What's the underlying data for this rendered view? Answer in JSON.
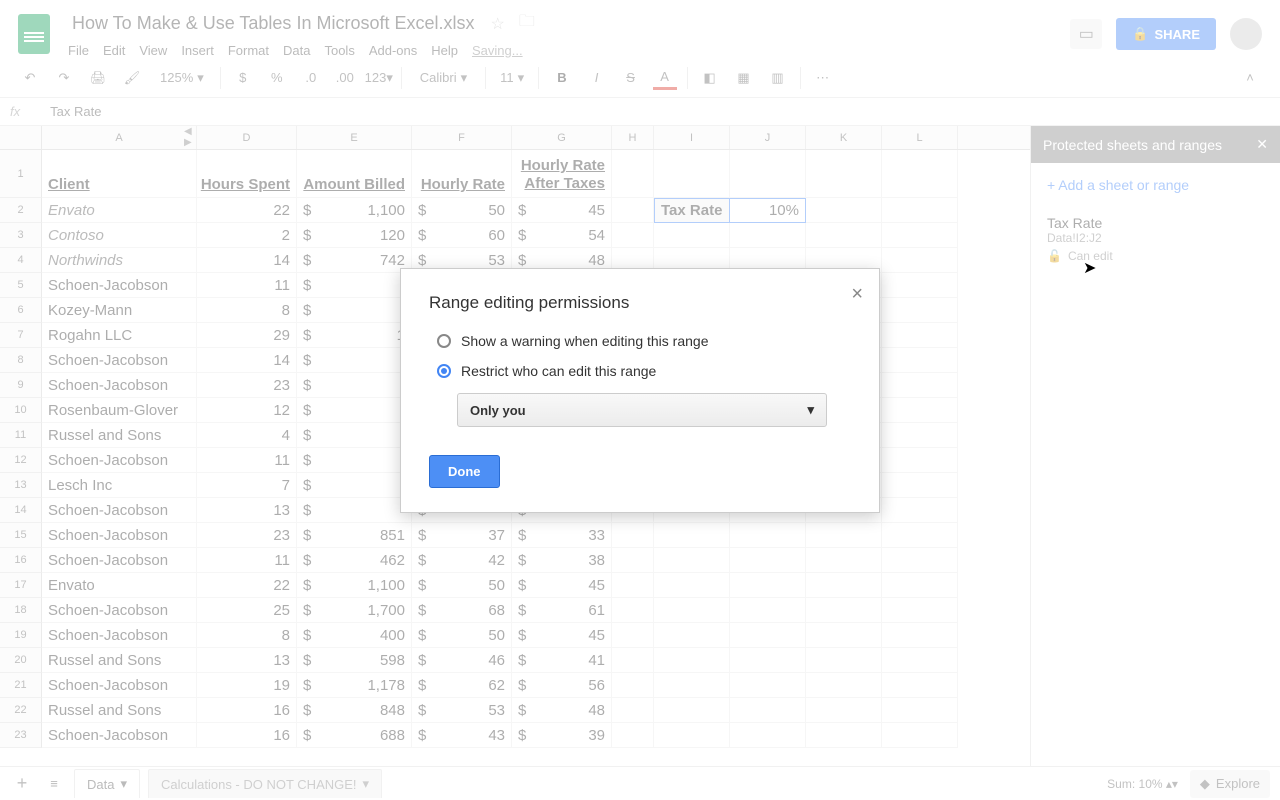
{
  "header": {
    "doc_title": "How To Make & Use Tables In Microsoft Excel.xlsx",
    "menu": {
      "file": "File",
      "edit": "Edit",
      "view": "View",
      "insert": "Insert",
      "format": "Format",
      "data": "Data",
      "tools": "Tools",
      "addons": "Add-ons",
      "help": "Help",
      "saving": "Saving..."
    },
    "share": "SHARE"
  },
  "toolbar": {
    "zoom": "125%",
    "currency": "$",
    "percent": "%",
    "dec1": ".0",
    "dec2": ".00",
    "num": "123",
    "font": "Calibri",
    "font_size": "11"
  },
  "formula": {
    "value": "Tax Rate"
  },
  "columns": [
    "A",
    "D",
    "E",
    "F",
    "G",
    "H",
    "I",
    "J",
    "K",
    "L"
  ],
  "sheet": {
    "headers": {
      "client": "Client",
      "hours": "Hours Spent",
      "amount": "Amount Billed",
      "rate": "Hourly Rate",
      "after": "Hourly Rate After Taxes"
    },
    "taxrate_label": "Tax Rate",
    "taxrate_value": "10%",
    "rows": [
      {
        "n": 2,
        "client": "Envato",
        "hours": "22",
        "amt": "1,100",
        "rate": "50",
        "after": "45"
      },
      {
        "n": 3,
        "client": "Contoso",
        "hours": "2",
        "amt": "120",
        "rate": "60",
        "after": "54"
      },
      {
        "n": 4,
        "client": "Northwinds",
        "hours": "14",
        "amt": "742",
        "rate": "53",
        "after": "48"
      },
      {
        "n": 5,
        "client": "Schoen-Jacobson",
        "hours": "11",
        "amt": "",
        "rate": "",
        "after": ""
      },
      {
        "n": 6,
        "client": "Kozey-Mann",
        "hours": "8",
        "amt": "",
        "rate": "",
        "after": ""
      },
      {
        "n": 7,
        "client": "Rogahn LLC",
        "hours": "29",
        "amt": "1",
        "rate": "",
        "after": ""
      },
      {
        "n": 8,
        "client": "Schoen-Jacobson",
        "hours": "14",
        "amt": "",
        "rate": "",
        "after": ""
      },
      {
        "n": 9,
        "client": "Schoen-Jacobson",
        "hours": "23",
        "amt": "",
        "rate": "",
        "after": ""
      },
      {
        "n": 10,
        "client": "Rosenbaum-Glover",
        "hours": "12",
        "amt": "",
        "rate": "",
        "after": ""
      },
      {
        "n": 11,
        "client": "Russel and Sons",
        "hours": "4",
        "amt": "",
        "rate": "",
        "after": ""
      },
      {
        "n": 12,
        "client": "Schoen-Jacobson",
        "hours": "11",
        "amt": "",
        "rate": "",
        "after": ""
      },
      {
        "n": 13,
        "client": "Lesch Inc",
        "hours": "7",
        "amt": "",
        "rate": "",
        "after": ""
      },
      {
        "n": 14,
        "client": "Schoen-Jacobson",
        "hours": "13",
        "amt": "",
        "rate": "",
        "after": ""
      },
      {
        "n": 15,
        "client": "Schoen-Jacobson",
        "hours": "23",
        "amt": "851",
        "rate": "37",
        "after": "33"
      },
      {
        "n": 16,
        "client": "Schoen-Jacobson",
        "hours": "11",
        "amt": "462",
        "rate": "42",
        "after": "38"
      },
      {
        "n": 17,
        "client": "Envato",
        "hours": "22",
        "amt": "1,100",
        "rate": "50",
        "after": "45"
      },
      {
        "n": 18,
        "client": "Schoen-Jacobson",
        "hours": "25",
        "amt": "1,700",
        "rate": "68",
        "after": "61"
      },
      {
        "n": 19,
        "client": "Schoen-Jacobson",
        "hours": "8",
        "amt": "400",
        "rate": "50",
        "after": "45"
      },
      {
        "n": 20,
        "client": "Russel and Sons",
        "hours": "13",
        "amt": "598",
        "rate": "46",
        "after": "41"
      },
      {
        "n": 21,
        "client": "Schoen-Jacobson",
        "hours": "19",
        "amt": "1,178",
        "rate": "62",
        "after": "56"
      },
      {
        "n": 22,
        "client": "Russel and Sons",
        "hours": "16",
        "amt": "848",
        "rate": "53",
        "after": "48"
      },
      {
        "n": 23,
        "client": "Schoen-Jacobson",
        "hours": "16",
        "amt": "688",
        "rate": "43",
        "after": "39"
      }
    ]
  },
  "panel": {
    "title": "Protected sheets and ranges",
    "add": "+ Add a sheet or range",
    "item_title": "Tax Rate",
    "item_sub": "Data!I2:J2",
    "can_edit": "Can edit"
  },
  "modal": {
    "title": "Range editing permissions",
    "opt_warn": "Show a warning when editing this range",
    "opt_restrict": "Restrict who can edit this range",
    "select_value": "Only you",
    "done": "Done"
  },
  "bottom": {
    "tab1": "Data",
    "tab2": "Calculations - DO NOT CHANGE!",
    "sum": "Sum: 10%",
    "explore": "Explore"
  }
}
